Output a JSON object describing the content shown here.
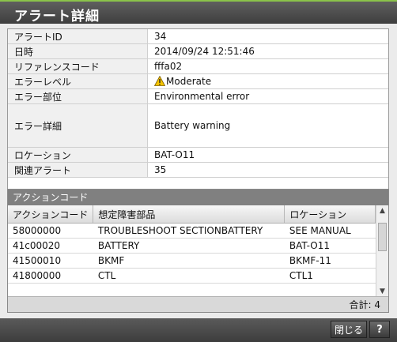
{
  "window": {
    "title": "アラート詳細"
  },
  "details": [
    {
      "label": "アラートID",
      "value": "34"
    },
    {
      "label": "日時",
      "value": "2014/09/24 12:51:46"
    },
    {
      "label": "リファレンスコード",
      "value": "fffa02"
    },
    {
      "label": "エラーレベル",
      "value": "Moderate",
      "icon": "warning-icon"
    },
    {
      "label": "エラー部位",
      "value": "Environmental error"
    },
    {
      "label": "エラー詳細",
      "value": "Battery warning"
    },
    {
      "label": "ロケーション",
      "value": "BAT-O11"
    },
    {
      "label": "関連アラート",
      "value": "35"
    }
  ],
  "action_codes": {
    "header": "アクションコード",
    "columns": [
      "アクションコード",
      "想定障害部品",
      "ロケーション"
    ],
    "rows": [
      [
        "58000000",
        "TROUBLESHOOT SECTIONBATTERY",
        "SEE MANUAL"
      ],
      [
        "41c00020",
        "BATTERY",
        "BAT-O11"
      ],
      [
        "41500010",
        "BKMF",
        "BKMF-11"
      ],
      [
        "41800000",
        "CTL",
        "CTL1"
      ]
    ],
    "total": "合計: 4"
  },
  "buttons": {
    "close": "閉じる",
    "help": "?"
  },
  "colors": {
    "accent": "#8bc34a",
    "warning": "#f5c400"
  }
}
